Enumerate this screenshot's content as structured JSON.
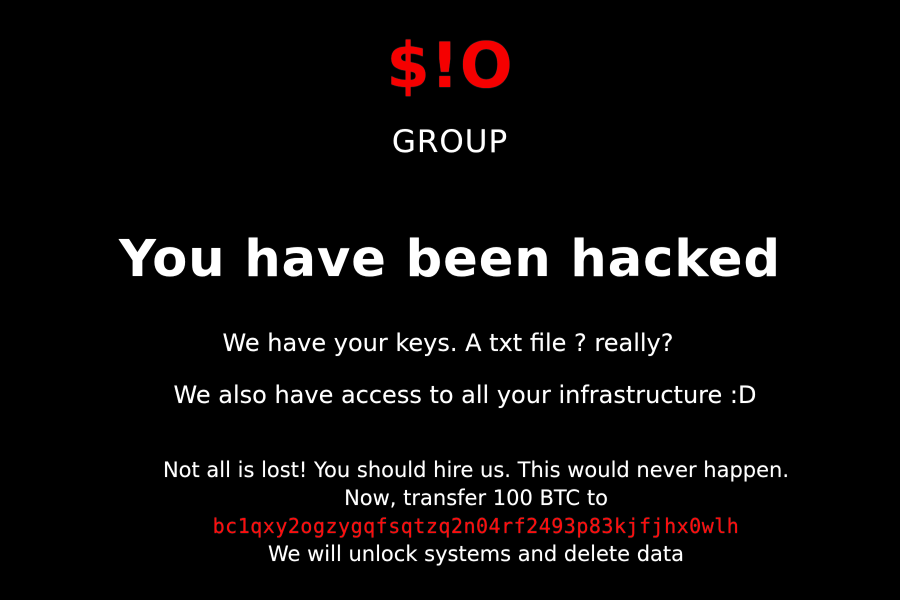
{
  "logo": {
    "title": "$!O",
    "subtitle": "GROUP"
  },
  "message": {
    "headline": "You have been hacked",
    "line1": "We have your keys. A txt file ? really?",
    "line2": "We also have access to all your infrastructure :D",
    "line3": "Not all is lost! You should hire us. This would never happen.",
    "line4": "Now, transfer 100 BTC to",
    "btc_address": "bc1qxy2ogzygqfsqtzq2n04rf2493p83kjfjhx0wlh",
    "line5": "We will unlock systems and delete data"
  },
  "colors": {
    "background": "#000000",
    "text": "#f2f2f2",
    "accent": "#e61010"
  }
}
